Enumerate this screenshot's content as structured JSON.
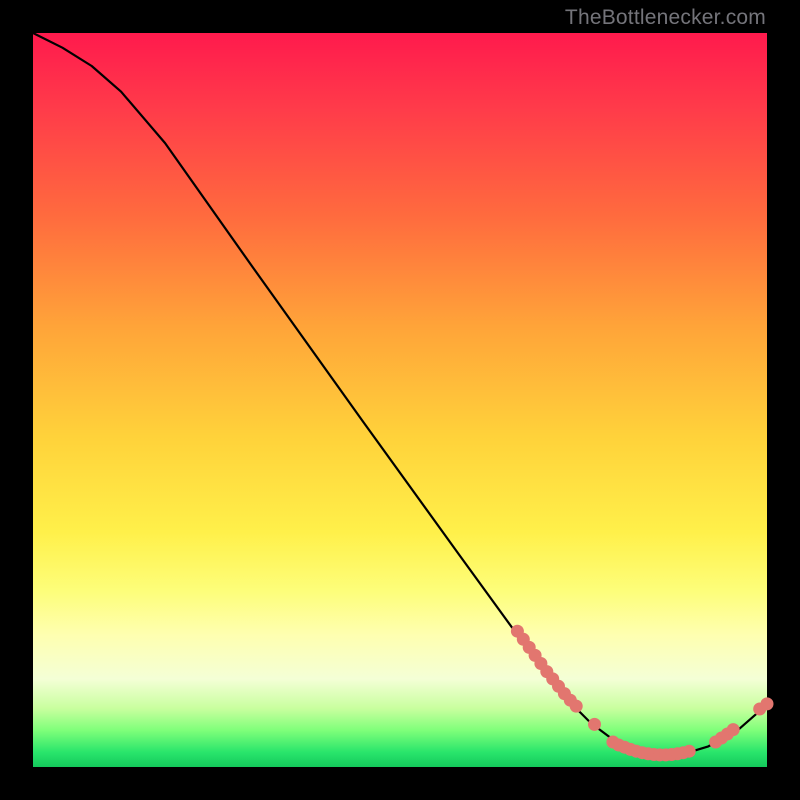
{
  "attribution": "TheBottlenecker.com",
  "colors": {
    "dot": "#e2766f",
    "curve": "#000000",
    "background": "#000000"
  },
  "chart_data": {
    "type": "line",
    "title": "",
    "xlabel": "",
    "ylabel": "",
    "xlim": [
      0,
      100
    ],
    "ylim": [
      0,
      100
    ],
    "curve_points": [
      {
        "x": 0,
        "y": 100
      },
      {
        "x": 4,
        "y": 98
      },
      {
        "x": 8,
        "y": 95.5
      },
      {
        "x": 12,
        "y": 92
      },
      {
        "x": 18,
        "y": 85
      },
      {
        "x": 30,
        "y": 68
      },
      {
        "x": 45,
        "y": 47
      },
      {
        "x": 58,
        "y": 29
      },
      {
        "x": 66,
        "y": 18
      },
      {
        "x": 72,
        "y": 10
      },
      {
        "x": 76,
        "y": 6
      },
      {
        "x": 80,
        "y": 3
      },
      {
        "x": 84,
        "y": 1.7
      },
      {
        "x": 88,
        "y": 1.6
      },
      {
        "x": 92,
        "y": 2.8
      },
      {
        "x": 96,
        "y": 5
      },
      {
        "x": 100,
        "y": 8.5
      }
    ],
    "highlight_clusters": [
      {
        "label": "descent-band",
        "points": [
          {
            "x": 66,
            "y": 18.5
          },
          {
            "x": 66.8,
            "y": 17.4
          },
          {
            "x": 67.6,
            "y": 16.3
          },
          {
            "x": 68.4,
            "y": 15.2
          },
          {
            "x": 69.2,
            "y": 14.1
          },
          {
            "x": 70.0,
            "y": 13.0
          },
          {
            "x": 70.8,
            "y": 12.0
          },
          {
            "x": 71.6,
            "y": 11.0
          },
          {
            "x": 72.4,
            "y": 10.0
          },
          {
            "x": 73.2,
            "y": 9.1
          },
          {
            "x": 74.0,
            "y": 8.3
          }
        ]
      },
      {
        "label": "lone-mid",
        "points": [
          {
            "x": 76.5,
            "y": 5.8
          }
        ]
      },
      {
        "label": "valley-floor",
        "points": [
          {
            "x": 79.0,
            "y": 3.4
          },
          {
            "x": 79.8,
            "y": 3.0
          },
          {
            "x": 80.6,
            "y": 2.7
          },
          {
            "x": 81.4,
            "y": 2.4
          },
          {
            "x": 82.2,
            "y": 2.15
          },
          {
            "x": 83.0,
            "y": 1.95
          },
          {
            "x": 83.8,
            "y": 1.8
          },
          {
            "x": 84.6,
            "y": 1.7
          },
          {
            "x": 85.4,
            "y": 1.65
          },
          {
            "x": 86.2,
            "y": 1.65
          },
          {
            "x": 87.0,
            "y": 1.7
          },
          {
            "x": 87.8,
            "y": 1.8
          },
          {
            "x": 88.6,
            "y": 1.95
          },
          {
            "x": 89.4,
            "y": 2.15
          }
        ]
      },
      {
        "label": "rise-band",
        "points": [
          {
            "x": 93.0,
            "y": 3.4
          },
          {
            "x": 93.8,
            "y": 3.95
          },
          {
            "x": 94.6,
            "y": 4.5
          },
          {
            "x": 95.4,
            "y": 5.1
          }
        ]
      },
      {
        "label": "top-pair",
        "points": [
          {
            "x": 99.0,
            "y": 7.9
          },
          {
            "x": 100.0,
            "y": 8.6
          }
        ]
      }
    ]
  }
}
